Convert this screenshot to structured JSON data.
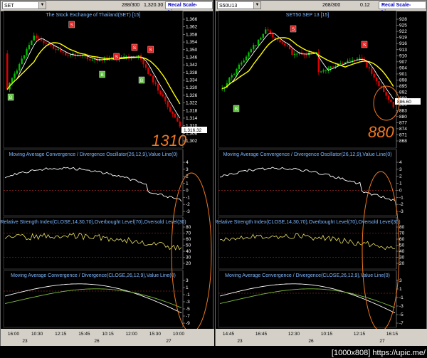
{
  "left": {
    "symbol": "SET",
    "count": "288/300",
    "last_value": "1,320.30",
    "recal_label": "Recal Scale-Linear",
    "price_title": "The Stock Exchange of Thailand(SET) [15]",
    "price_ticks": [
      "1,366",
      "1,362",
      "1,358",
      "1,354",
      "1,350",
      "1,346",
      "1,342",
      "1,338",
      "1,334",
      "1,330",
      "1,326",
      "1,322",
      "1,318",
      "1,314",
      "1,310",
      "1,306",
      "1,302"
    ],
    "price_marker": "1,316.32",
    "annotation": "1310",
    "macd_osc_title": "Moving Average Convergence / Divergence Oscillator(26,12,9),Value Line(0)",
    "macd_osc_ticks": [
      "4",
      "3",
      "2",
      "1",
      "0",
      "-1",
      "-2",
      "-3"
    ],
    "rsi_title": "Relative Strength Index(CLOSE,14,30,70),Overbought Level(70),Oversold Level(30)",
    "rsi_ticks": [
      "80",
      "70",
      "60",
      "50",
      "40",
      "30",
      "20"
    ],
    "macd_title": "Moving Average Convergence / Divergence(CLOSE,26,12,9),Value Line(0)",
    "macd_ticks": [
      "3",
      "1",
      "-1",
      "-3",
      "-5",
      "-7",
      "-9"
    ],
    "time_labels": [
      "16:00",
      "10:30",
      "12:15",
      "15:45",
      "10:15",
      "12:00",
      "15:30",
      "10:00"
    ],
    "date_labels": [
      "23",
      "26",
      "27"
    ],
    "signals": [
      "B",
      "S",
      "S",
      "S",
      "B",
      "S",
      "B"
    ]
  },
  "right": {
    "symbol": "S50U13",
    "count": "268/300",
    "last_value": "0.12",
    "recal_label": "Recal Scale-Linear",
    "price_title": "SET50 SEP 13 [15]",
    "price_ticks": [
      "928",
      "925",
      "922",
      "919",
      "916",
      "913",
      "910",
      "907",
      "904",
      "901",
      "898",
      "895",
      "892",
      "889",
      "886",
      "883",
      "880",
      "877",
      "874",
      "871",
      "868"
    ],
    "price_marker": "886.60",
    "annotation": "880",
    "macd_osc_title": "Moving Average Convergence / Divergence Oscillator(26,12,9),Value Line(0)",
    "macd_osc_ticks": [
      "4",
      "3",
      "2",
      "1",
      "0",
      "-1",
      "-2",
      "-3"
    ],
    "rsi_title": "Relative Strength Index(CLOSE,14,30,70),Overbought Level(70),Oversold Level(30)",
    "rsi_ticks": [
      "80",
      "70",
      "60",
      "50",
      "40",
      "30",
      "20"
    ],
    "macd_title": "Moving Average Convergence / Divergence(CLOSE,26,12,9),Value Line(0)",
    "macd_ticks": [
      "3",
      "1",
      "-1",
      "-3",
      "-5",
      "-7"
    ],
    "time_labels": [
      "14:45",
      "16:45",
      "12:30",
      "10:15",
      "12:15",
      "16:15"
    ],
    "date_labels": [
      "23",
      "26",
      "27"
    ],
    "signals": [
      "B",
      "S",
      "S"
    ]
  },
  "watermark": "[1000x808] https://upic.me/",
  "colors": {
    "price_ma": "#ffff00",
    "candle_up": "#00c000",
    "candle_down": "#e00000",
    "macd": "#ffffff",
    "rsi": "#e8e060",
    "signal_line": "#80c040",
    "grid": "#3a3a3a",
    "ann": "#f07820"
  }
}
